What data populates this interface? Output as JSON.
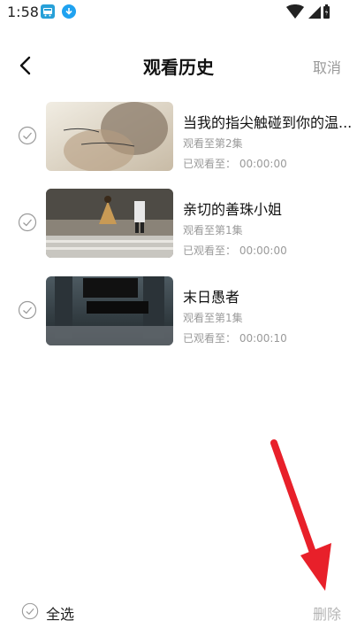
{
  "status_bar": {
    "time": "1:58",
    "icons": [
      "app-notification-icon",
      "download-icon",
      "wifi-icon",
      "signal-icon",
      "battery-icon"
    ]
  },
  "header": {
    "title": "观看历史",
    "cancel_label": "取消",
    "back_icon": "chevron-left-icon"
  },
  "history": [
    {
      "title": "当我的指尖触碰到你的温...",
      "episode": "观看至第2集",
      "progress": "已观看至： 00:00:00",
      "thumb_colors": [
        "#e9e3d7",
        "#7a6a5a"
      ]
    },
    {
      "title": "亲切的善珠小姐",
      "episode": "观看至第1集",
      "progress": "已观看至： 00:00:00",
      "thumb_colors": [
        "#8a7b6c",
        "#5c544a"
      ]
    },
    {
      "title": "末日愚者",
      "episode": "观看至第1集",
      "progress": "已观看至： 00:00:10",
      "thumb_colors": [
        "#3f4b52",
        "#1f2a30"
      ]
    }
  ],
  "bottom_bar": {
    "select_all_label": "全选",
    "delete_label": "删除"
  },
  "colors": {
    "muted_text": "#9a9a9a",
    "annotation_arrow": "#e8202a"
  }
}
